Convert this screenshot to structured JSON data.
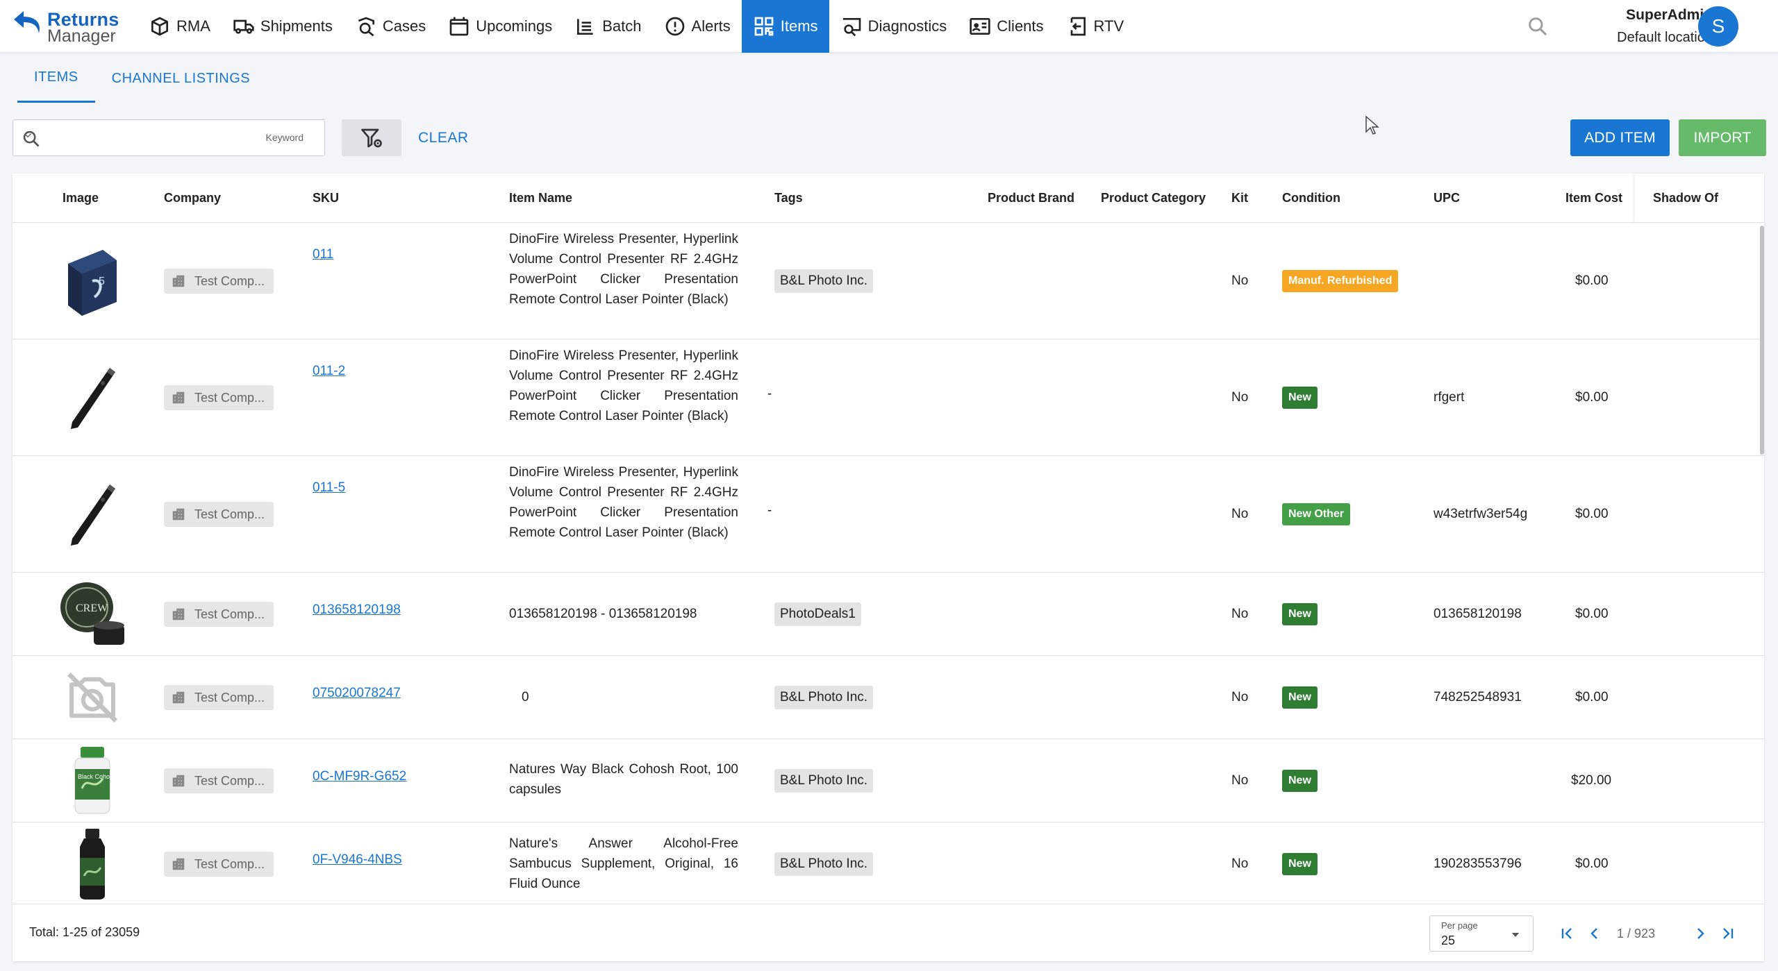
{
  "app": {
    "logo_line1": "Returns",
    "logo_line2": "Manager"
  },
  "nav": [
    {
      "label": "RMA",
      "icon": "cube-icon"
    },
    {
      "label": "Shipments",
      "icon": "truck-icon"
    },
    {
      "label": "Cases",
      "icon": "search-case-icon"
    },
    {
      "label": "Upcomings",
      "icon": "calendar-icon"
    },
    {
      "label": "Batch",
      "icon": "list-icon"
    },
    {
      "label": "Alerts",
      "icon": "alert-icon"
    },
    {
      "label": "Items",
      "icon": "qr-icon",
      "active": true
    },
    {
      "label": "Diagnostics",
      "icon": "diagnostics-icon"
    },
    {
      "label": "Clients",
      "icon": "id-card-icon"
    },
    {
      "label": "RTV",
      "icon": "return-box-icon"
    }
  ],
  "user": {
    "name": "SuperAdmin",
    "location": "Default location",
    "initial": "S"
  },
  "tabs": [
    {
      "label": "ITEMS",
      "active": true
    },
    {
      "label": "CHANNEL LISTINGS",
      "active": false
    }
  ],
  "toolbar": {
    "search_value": "",
    "keyword_label": "Keyword",
    "clear_label": "CLEAR",
    "add_label": "ADD ITEM",
    "import_label": "IMPORT"
  },
  "table": {
    "columns": [
      "Image",
      "Company",
      "SKU",
      "Item Name",
      "Tags",
      "Product Brand",
      "Product Category",
      "Kit",
      "Condition",
      "UPC",
      "Item Cost",
      "Shadow Of"
    ],
    "rows": [
      {
        "image": "gum-pack",
        "company": "Test Comp...",
        "sku": "011",
        "item_name": "DinoFire Wireless Presenter, Hyperlink Volume Control Presenter RF 2.4GHz PowerPoint Clicker Presentation Remote Control Laser Pointer (Black)",
        "tag": "B&L Photo Inc.",
        "brand": "",
        "category": "",
        "kit": "No",
        "condition": "Manuf. Refurbished",
        "condition_color": "#f5a623",
        "upc": "",
        "cost": "$0.00",
        "shadow_of": ""
      },
      {
        "image": "pen",
        "company": "Test Comp...",
        "sku": "011-2",
        "item_name": "DinoFire Wireless Presenter, Hyperlink Volume Control Presenter RF 2.4GHz PowerPoint Clicker Presentation Remote Control Laser Pointer (Black)",
        "tag": "-",
        "brand": "",
        "category": "",
        "kit": "No",
        "condition": "New",
        "condition_color": "#2e7d32",
        "upc": "rfgert",
        "cost": "$0.00",
        "shadow_of": ""
      },
      {
        "image": "pen",
        "company": "Test Comp...",
        "sku": "011-5",
        "item_name": "DinoFire Wireless Presenter, Hyperlink Volume Control Presenter RF 2.4GHz PowerPoint Clicker Presentation Remote Control Laser Pointer (Black)",
        "tag": "-",
        "brand": "",
        "category": "",
        "kit": "No",
        "condition": "New Other",
        "condition_color": "#43a047",
        "upc": "w43etrfw3er54g",
        "cost": "$0.00",
        "shadow_of": ""
      },
      {
        "image": "tin",
        "company": "Test Comp...",
        "sku": "013658120198",
        "item_name": "013658120198 - 013658120198",
        "tag": "PhotoDeals1",
        "brand": "",
        "category": "",
        "kit": "No",
        "condition": "New",
        "condition_color": "#2e7d32",
        "upc": "013658120198",
        "cost": "$0.00",
        "shadow_of": ""
      },
      {
        "image": "no-photo",
        "company": "Test Comp...",
        "sku": "075020078247",
        "item_name": "0",
        "tag": "B&L Photo Inc.",
        "brand": "",
        "category": "",
        "kit": "No",
        "condition": "New",
        "condition_color": "#2e7d32",
        "upc": "748252548931",
        "cost": "$0.00",
        "shadow_of": ""
      },
      {
        "image": "bottle-green",
        "company": "Test Comp...",
        "sku": "0C-MF9R-G652",
        "item_name": "Natures Way Black Cohosh Root, 100 capsules",
        "tag": "B&L Photo Inc.",
        "brand": "",
        "category": "",
        "kit": "No",
        "condition": "New",
        "condition_color": "#2e7d32",
        "upc": "",
        "cost": "$20.00",
        "shadow_of": ""
      },
      {
        "image": "bottle-dark",
        "company": "Test Comp...",
        "sku": "0F-V946-4NBS",
        "item_name": "Nature's Answer Alcohol-Free Sambucus Supplement, Original, 16 Fluid Ounce",
        "tag": "B&L Photo Inc.",
        "brand": "",
        "category": "",
        "kit": "No",
        "condition": "New",
        "condition_color": "#2e7d32",
        "upc": "190283553796",
        "cost": "$0.00",
        "shadow_of": ""
      }
    ]
  },
  "footer": {
    "total": "Total: 1-25 of 23059",
    "per_page_label": "Per page",
    "per_page_value": "25",
    "page_text": "1 / 923"
  }
}
